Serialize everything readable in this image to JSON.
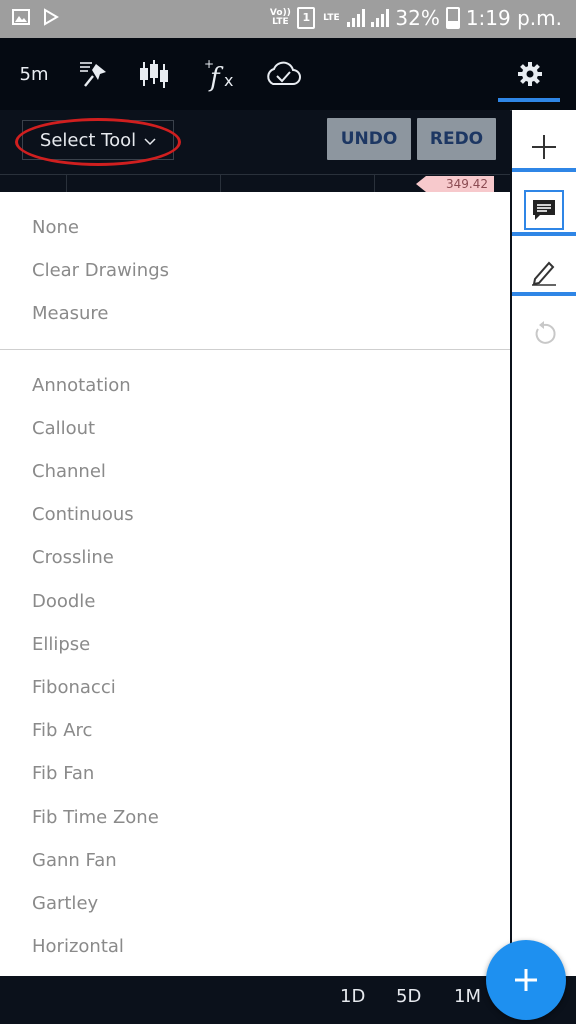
{
  "status_bar": {
    "carrier_label": "Vo)) LTE",
    "sim_slot": "1",
    "network_label": "LTE",
    "battery": "32%",
    "time": "1:19 p.m."
  },
  "toolbar": {
    "interval": "5m",
    "icons": [
      "pin-icon",
      "candlestick-icon",
      "function-icon",
      "cloud-icon",
      "gear-icon"
    ]
  },
  "drawing_bar": {
    "select_tool_label": "Select Tool",
    "undo_label": "UNDO",
    "redo_label": "REDO"
  },
  "chart": {
    "price_tag": "349.42"
  },
  "dropdown": {
    "group1": [
      "None",
      "Clear Drawings",
      "Measure"
    ],
    "group2": [
      "Annotation",
      "Callout",
      "Channel",
      "Continuous",
      "Crossline",
      "Doodle",
      "Ellipse",
      "Fibonacci",
      "Fib Arc",
      "Fib Fan",
      "Fib Time Zone",
      "Gann Fan",
      "Gartley",
      "Horizontal"
    ]
  },
  "bottom_bar": {
    "ranges": [
      "1D",
      "5D",
      "1M"
    ]
  },
  "colors": {
    "accent": "#2f86e6",
    "annotation_circle": "#d01f1f",
    "toolbar_bg": "#050a12"
  }
}
